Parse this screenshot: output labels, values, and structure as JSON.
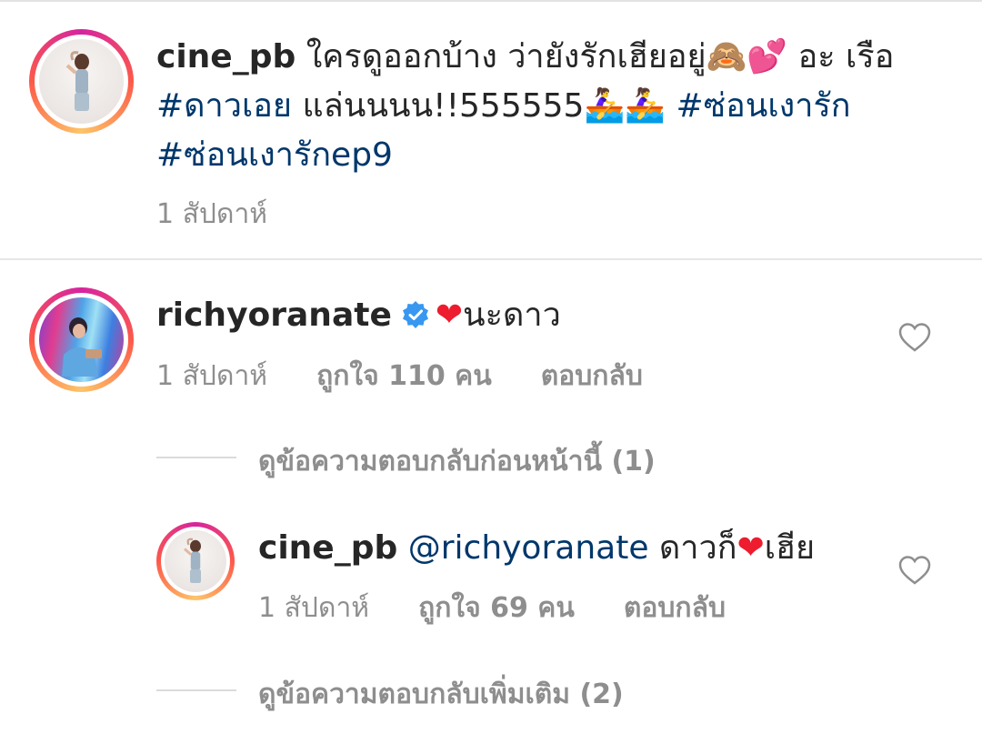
{
  "caption": {
    "username": "cine_pb",
    "text_1": "ใครดูออกบ้าง ว่ายังรักเฮียอยู่",
    "emoji_1": "🙈💕",
    "text_2": " อะ เรือ",
    "hashtag_1": "#ดาวเอย",
    "text_3": " แล่นนนน!!555555",
    "emoji_2": "🚣‍♀️🚣‍♀️",
    "hashtag_2": "#ซ่อนเงารัก",
    "hashtag_3": "#ซ่อนเงารักep9",
    "time": "1 สัปดาห์"
  },
  "comment": {
    "username": "richyoranate",
    "heart": "❤",
    "text": "นะดาว",
    "time": "1 สัปดาห์",
    "likes": "ถูกใจ 110 คน",
    "reply_label": "ตอบกลับ"
  },
  "view_previous_replies": "ดูข้อความตอบกลับก่อนหน้านี้ (1)",
  "reply": {
    "username": "cine_pb",
    "mention": "@richyoranate",
    "text_1": " ดาวก็",
    "heart": "❤",
    "text_2": "เฮีย",
    "time": "1 สัปดาห์",
    "likes": "ถูกใจ 69 คน",
    "reply_label": "ตอบกลับ"
  },
  "view_more_replies": "ดูข้อความตอบกลับเพิ่มเติม (2)",
  "colors": {
    "link": "#00376b",
    "meta": "#8e8e8e",
    "verified": "#3897f0",
    "heart": "#ed1c2e"
  },
  "icons": [
    "verified-badge-icon",
    "heart-outline-icon"
  ]
}
